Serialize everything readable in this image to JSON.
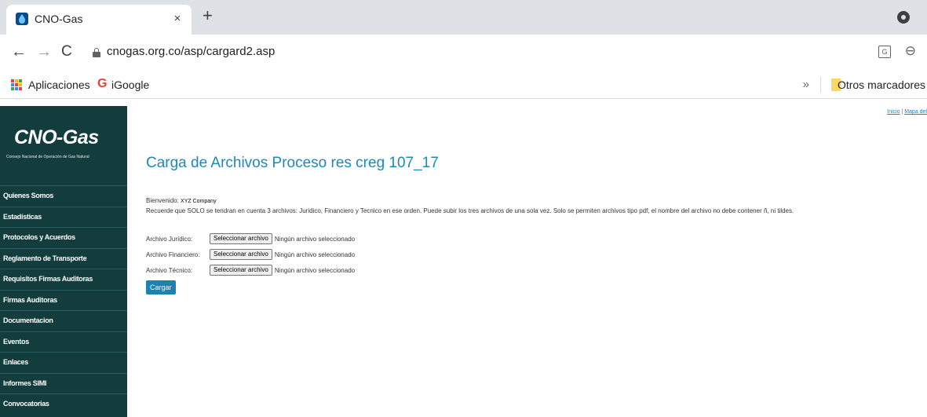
{
  "browser": {
    "tab_title": "CNO-Gas",
    "tab_close": "×",
    "new_tab": "+",
    "nav": {
      "back": "←",
      "forward": "→",
      "reload": "C"
    },
    "url": "cnogas.org.co/asp/cargard2.asp",
    "bookmarks": {
      "apps_label": "Aplicaciones",
      "igoogle_icon": "G",
      "igoogle_label": "iGoogle",
      "more": "»",
      "other_label": "Otros marcadores"
    },
    "icons": [
      "cno-gas-favicon",
      "profile-icon",
      "lock-icon",
      "translate-icon",
      "zoom-icon",
      "apps-icon",
      "google-icon",
      "folder-icon"
    ]
  },
  "sidebar": {
    "logo_title": "CNO-Gas",
    "logo_subtitle": "Consejo Nacional de Operación de Gas Natural",
    "items": [
      {
        "label": "Quienes Somos"
      },
      {
        "label": "Estadísticas"
      },
      {
        "label": "Protocolos y Acuerdos"
      },
      {
        "label": "Reglamento de Transporte"
      },
      {
        "label": "Requisitos Firmas Auditoras"
      },
      {
        "label": "Firmas Auditoras"
      },
      {
        "label": "Documentacion"
      },
      {
        "label": "Eventos"
      },
      {
        "label": "Enlaces"
      },
      {
        "label": "Informes SIMI"
      },
      {
        "label": "Convocatorias"
      }
    ],
    "colors": {
      "background": "#133d3d"
    }
  },
  "header_links": {
    "inicio": "Inicio",
    "sep": "|",
    "mapa": "Mapa del"
  },
  "main": {
    "title": "Carga de Archivos Proceso res creg 107_17",
    "welcome_label": "Bienvenido:",
    "welcome_name": "XYZ Company",
    "notice": "Recuerde que SOLO se tendran en cuenta 3 archivos: Juridico, Financiero y Tecnico en ese orden. Puede subir los tres archivos de una sola vez. Solo se permiten archivos tipo pdf, el nombre del archivo no debe contener ñ, ni tildes.",
    "files": [
      {
        "label": "Archivo Jurídico:",
        "button": "Seleccionar archivo",
        "status": "Ningún archivo seleccionado"
      },
      {
        "label": "Archivo Financiero:",
        "button": "Seleccionar archivo",
        "status": "Ningún archivo seleccionado"
      },
      {
        "label": "Archivo Técnico:",
        "button": "Seleccionar archivo",
        "status": "Ningún archivo seleccionado"
      }
    ],
    "submit_label": "Cargar",
    "colors": {
      "accent": "#1b82b1",
      "title": "#1b8ab8"
    }
  }
}
